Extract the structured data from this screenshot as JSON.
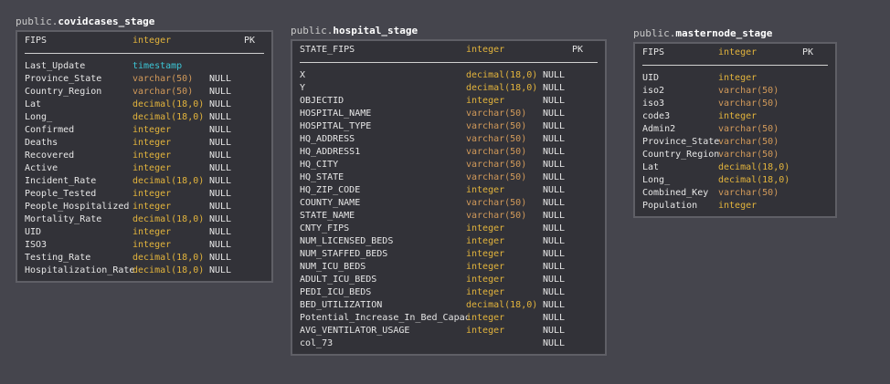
{
  "colors": {
    "background": "#45454d",
    "box_background": "#323238",
    "box_border": "#5f5f66",
    "type_color": "#e3b43c",
    "varchar_color": "#d29a5a",
    "timestamp_color": "#3cc6d6"
  },
  "tables": [
    {
      "schema": "public.",
      "name": "covidcases_stage",
      "pk": {
        "name": "FIPS",
        "type": "integer",
        "flag": "PK"
      },
      "columns": [
        {
          "name": "Last_Update",
          "type": "timestamp",
          "null": ""
        },
        {
          "name": "Province_State",
          "type": "varchar(50)",
          "null": "NULL"
        },
        {
          "name": "Country_Region",
          "type": "varchar(50)",
          "null": "NULL"
        },
        {
          "name": "Lat",
          "type": "decimal(18,0)",
          "null": "NULL"
        },
        {
          "name": "Long_",
          "type": "decimal(18,0)",
          "null": "NULL"
        },
        {
          "name": "Confirmed",
          "type": "integer",
          "null": "NULL"
        },
        {
          "name": "Deaths",
          "type": "integer",
          "null": "NULL"
        },
        {
          "name": "Recovered",
          "type": "integer",
          "null": "NULL"
        },
        {
          "name": "Active",
          "type": "integer",
          "null": "NULL"
        },
        {
          "name": "Incident_Rate",
          "type": "decimal(18,0)",
          "null": "NULL"
        },
        {
          "name": "People_Tested",
          "type": "integer",
          "null": "NULL"
        },
        {
          "name": "People_Hospitalized",
          "type": "integer",
          "null": "NULL"
        },
        {
          "name": "Mortality_Rate",
          "type": "decimal(18,0)",
          "null": "NULL"
        },
        {
          "name": "UID",
          "type": "integer",
          "null": "NULL"
        },
        {
          "name": "ISO3",
          "type": "integer",
          "null": "NULL"
        },
        {
          "name": "Testing_Rate",
          "type": "decimal(18,0)",
          "null": "NULL"
        },
        {
          "name": "Hospitalization_Rate",
          "type": "decimal(18,0)",
          "null": "NULL"
        }
      ]
    },
    {
      "schema": "public.",
      "name": "hospital_stage",
      "pk": {
        "name": "STATE_FIPS",
        "type": "integer",
        "flag": "PK"
      },
      "columns": [
        {
          "name": "X",
          "type": "decimal(18,0)",
          "null": "NULL"
        },
        {
          "name": "Y",
          "type": "decimal(18,0)",
          "null": "NULL"
        },
        {
          "name": "OBJECTID",
          "type": "integer",
          "null": "NULL"
        },
        {
          "name": "HOSPITAL_NAME",
          "type": "varchar(50)",
          "null": "NULL"
        },
        {
          "name": "HOSPITAL_TYPE",
          "type": "varchar(50)",
          "null": "NULL"
        },
        {
          "name": "HQ_ADDRESS",
          "type": "varchar(50)",
          "null": "NULL"
        },
        {
          "name": "HQ_ADDRESS1",
          "type": "varchar(50)",
          "null": "NULL"
        },
        {
          "name": "HQ_CITY",
          "type": "varchar(50)",
          "null": "NULL"
        },
        {
          "name": "HQ_STATE",
          "type": "varchar(50)",
          "null": "NULL"
        },
        {
          "name": "HQ_ZIP_CODE",
          "type": "integer",
          "null": "NULL"
        },
        {
          "name": "COUNTY_NAME",
          "type": "varchar(50)",
          "null": "NULL"
        },
        {
          "name": "STATE_NAME",
          "type": "varchar(50)",
          "null": "NULL"
        },
        {
          "name": "CNTY_FIPS",
          "type": "integer",
          "null": "NULL"
        },
        {
          "name": "NUM_LICENSED_BEDS",
          "type": "integer",
          "null": "NULL"
        },
        {
          "name": "NUM_STAFFED_BEDS",
          "type": "integer",
          "null": "NULL"
        },
        {
          "name": "NUM_ICU_BEDS",
          "type": "integer",
          "null": "NULL"
        },
        {
          "name": "ADULT_ICU_BEDS",
          "type": "integer",
          "null": "NULL"
        },
        {
          "name": "PEDI_ICU_BEDS",
          "type": "integer",
          "null": "NULL"
        },
        {
          "name": "BED_UTILIZATION",
          "type": "decimal(18,0)",
          "null": "NULL"
        },
        {
          "name": "Potential_Increase_In_Bed_Capac",
          "type": "integer",
          "null": "NULL"
        },
        {
          "name": "AVG_VENTILATOR_USAGE",
          "type": "integer",
          "null": "NULL"
        },
        {
          "name": "col_73",
          "type": "",
          "null": "NULL"
        }
      ]
    },
    {
      "schema": "public.",
      "name": "masternode_stage",
      "pk": {
        "name": "FIPS",
        "type": "integer",
        "flag": "PK"
      },
      "columns": [
        {
          "name": "UID",
          "type": "integer",
          "null": ""
        },
        {
          "name": "iso2",
          "type": "varchar(50)",
          "null": ""
        },
        {
          "name": "iso3",
          "type": "varchar(50)",
          "null": ""
        },
        {
          "name": "code3",
          "type": "integer",
          "null": ""
        },
        {
          "name": "Admin2",
          "type": "varchar(50)",
          "null": ""
        },
        {
          "name": "Province_State",
          "type": "varchar(50)",
          "null": ""
        },
        {
          "name": "Country_Region",
          "type": "varchar(50)",
          "null": ""
        },
        {
          "name": "Lat",
          "type": "decimal(18,0)",
          "null": ""
        },
        {
          "name": "Long_",
          "type": "decimal(18,0)",
          "null": ""
        },
        {
          "name": "Combined_Key",
          "type": "varchar(50)",
          "null": ""
        },
        {
          "name": "Population",
          "type": "integer",
          "null": ""
        }
      ]
    }
  ]
}
